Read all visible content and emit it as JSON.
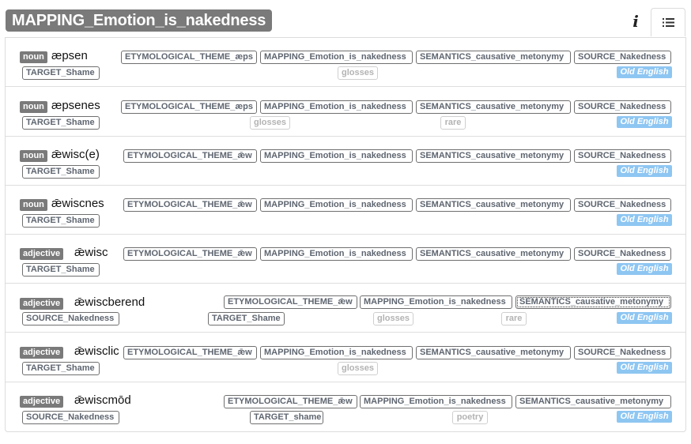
{
  "header": {
    "title": "MAPPING_Emotion_is_nakedness",
    "info_label": "i",
    "list_icon": "list-icon"
  },
  "entries": [
    {
      "pos": "noun",
      "word": "æpsen",
      "tags": [
        "ETYMOLOGICAL_THEME_æps",
        "MAPPING_Emotion_is_nakedness",
        "SEMANTICS_causative_metonymy",
        "SOURCE_Nakedness",
        "TARGET_Shame"
      ],
      "notes": [
        "glosses"
      ],
      "language": "Old English"
    },
    {
      "pos": "noun",
      "word": "æpsenes",
      "tags": [
        "ETYMOLOGICAL_THEME_æps",
        "MAPPING_Emotion_is_nakedness",
        "SEMANTICS_causative_metonymy",
        "SOURCE_Nakedness",
        "TARGET_Shame"
      ],
      "notes": [
        "glosses",
        "rare"
      ],
      "language": "Old English"
    },
    {
      "pos": "noun",
      "word": "ǣwisc(e)",
      "tags": [
        "ETYMOLOGICAL_THEME_ǣw",
        "MAPPING_Emotion_is_nakedness",
        "SEMANTICS_causative_metonymy",
        "SOURCE_Nakedness",
        "TARGET_Shame"
      ],
      "notes": [],
      "language": "Old English"
    },
    {
      "pos": "noun",
      "word": "ǣwiscnes",
      "tags": [
        "ETYMOLOGICAL_THEME_ǣw",
        "MAPPING_Emotion_is_nakedness",
        "SEMANTICS_causative_metonymy",
        "SOURCE_Nakedness",
        "TARGET_Shame"
      ],
      "notes": [],
      "language": "Old English"
    },
    {
      "pos": "adjective",
      "word": "ǣwisc",
      "tags": [
        "ETYMOLOGICAL_THEME_ǣw",
        "MAPPING_Emotion_is_nakedness",
        "SEMANTICS_causative_metonymy",
        "SOURCE_Nakedness",
        "TARGET_Shame"
      ],
      "notes": [],
      "language": "Old English"
    },
    {
      "pos": "adjective",
      "word": "ǣwiscberend",
      "tags": [
        "ETYMOLOGICAL_THEME_ǣw",
        "MAPPING_Emotion_is_nakedness",
        "SEMANTICS_causative_metonymy",
        "SOURCE_Nakedness",
        "TARGET_Shame"
      ],
      "notes": [
        "glosses",
        "rare"
      ],
      "language": "Old English"
    },
    {
      "pos": "adjective",
      "word": "ǣwisclic",
      "tags": [
        "ETYMOLOGICAL_THEME_ǣw",
        "MAPPING_Emotion_is_nakedness",
        "SEMANTICS_causative_metonymy",
        "SOURCE_Nakedness",
        "TARGET_Shame"
      ],
      "notes": [
        "glosses"
      ],
      "language": "Old English"
    },
    {
      "pos": "adjective",
      "word": "ǣwiscmōd",
      "tags": [
        "ETYMOLOGICAL_THEME_ǣw",
        "MAPPING_Emotion_is_nakedness",
        "SEMANTICS_causative_metonymy",
        "SOURCE_Nakedness",
        "TARGET_shame"
      ],
      "notes": [
        "poetry"
      ],
      "language": "Old English"
    }
  ],
  "colors": {
    "badge_bg": "#7a7a7a",
    "language_badge": "#8ec6f2",
    "tag_text": "#5f6670"
  }
}
